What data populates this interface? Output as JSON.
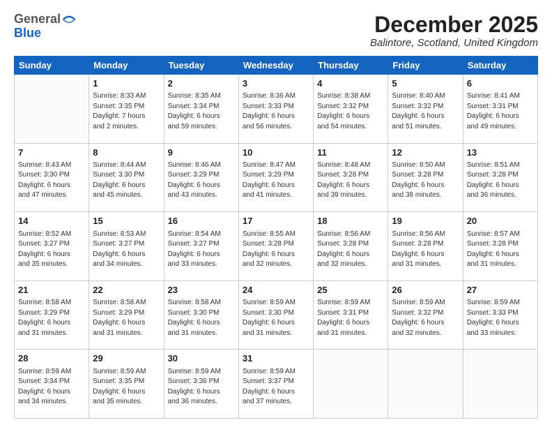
{
  "header": {
    "logo_general": "General",
    "logo_blue": "Blue",
    "month_title": "December 2025",
    "location": "Balintore, Scotland, United Kingdom"
  },
  "weekdays": [
    "Sunday",
    "Monday",
    "Tuesday",
    "Wednesday",
    "Thursday",
    "Friday",
    "Saturday"
  ],
  "weeks": [
    [
      {
        "day": "",
        "info": ""
      },
      {
        "day": "1",
        "info": "Sunrise: 8:33 AM\nSunset: 3:35 PM\nDaylight: 7 hours\nand 2 minutes."
      },
      {
        "day": "2",
        "info": "Sunrise: 8:35 AM\nSunset: 3:34 PM\nDaylight: 6 hours\nand 59 minutes."
      },
      {
        "day": "3",
        "info": "Sunrise: 8:36 AM\nSunset: 3:33 PM\nDaylight: 6 hours\nand 56 minutes."
      },
      {
        "day": "4",
        "info": "Sunrise: 8:38 AM\nSunset: 3:32 PM\nDaylight: 6 hours\nand 54 minutes."
      },
      {
        "day": "5",
        "info": "Sunrise: 8:40 AM\nSunset: 3:32 PM\nDaylight: 6 hours\nand 51 minutes."
      },
      {
        "day": "6",
        "info": "Sunrise: 8:41 AM\nSunset: 3:31 PM\nDaylight: 6 hours\nand 49 minutes."
      }
    ],
    [
      {
        "day": "7",
        "info": "Sunrise: 8:43 AM\nSunset: 3:30 PM\nDaylight: 6 hours\nand 47 minutes."
      },
      {
        "day": "8",
        "info": "Sunrise: 8:44 AM\nSunset: 3:30 PM\nDaylight: 6 hours\nand 45 minutes."
      },
      {
        "day": "9",
        "info": "Sunrise: 8:46 AM\nSunset: 3:29 PM\nDaylight: 6 hours\nand 43 minutes."
      },
      {
        "day": "10",
        "info": "Sunrise: 8:47 AM\nSunset: 3:29 PM\nDaylight: 6 hours\nand 41 minutes."
      },
      {
        "day": "11",
        "info": "Sunrise: 8:48 AM\nSunset: 3:28 PM\nDaylight: 6 hours\nand 39 minutes."
      },
      {
        "day": "12",
        "info": "Sunrise: 8:50 AM\nSunset: 3:28 PM\nDaylight: 6 hours\nand 38 minutes."
      },
      {
        "day": "13",
        "info": "Sunrise: 8:51 AM\nSunset: 3:28 PM\nDaylight: 6 hours\nand 36 minutes."
      }
    ],
    [
      {
        "day": "14",
        "info": "Sunrise: 8:52 AM\nSunset: 3:27 PM\nDaylight: 6 hours\nand 35 minutes."
      },
      {
        "day": "15",
        "info": "Sunrise: 8:53 AM\nSunset: 3:27 PM\nDaylight: 6 hours\nand 34 minutes."
      },
      {
        "day": "16",
        "info": "Sunrise: 8:54 AM\nSunset: 3:27 PM\nDaylight: 6 hours\nand 33 minutes."
      },
      {
        "day": "17",
        "info": "Sunrise: 8:55 AM\nSunset: 3:28 PM\nDaylight: 6 hours\nand 32 minutes."
      },
      {
        "day": "18",
        "info": "Sunrise: 8:56 AM\nSunset: 3:28 PM\nDaylight: 6 hours\nand 32 minutes."
      },
      {
        "day": "19",
        "info": "Sunrise: 8:56 AM\nSunset: 3:28 PM\nDaylight: 6 hours\nand 31 minutes."
      },
      {
        "day": "20",
        "info": "Sunrise: 8:57 AM\nSunset: 3:28 PM\nDaylight: 6 hours\nand 31 minutes."
      }
    ],
    [
      {
        "day": "21",
        "info": "Sunrise: 8:58 AM\nSunset: 3:29 PM\nDaylight: 6 hours\nand 31 minutes."
      },
      {
        "day": "22",
        "info": "Sunrise: 8:58 AM\nSunset: 3:29 PM\nDaylight: 6 hours\nand 31 minutes."
      },
      {
        "day": "23",
        "info": "Sunrise: 8:58 AM\nSunset: 3:30 PM\nDaylight: 6 hours\nand 31 minutes."
      },
      {
        "day": "24",
        "info": "Sunrise: 8:59 AM\nSunset: 3:30 PM\nDaylight: 6 hours\nand 31 minutes."
      },
      {
        "day": "25",
        "info": "Sunrise: 8:59 AM\nSunset: 3:31 PM\nDaylight: 6 hours\nand 31 minutes."
      },
      {
        "day": "26",
        "info": "Sunrise: 8:59 AM\nSunset: 3:32 PM\nDaylight: 6 hours\nand 32 minutes."
      },
      {
        "day": "27",
        "info": "Sunrise: 8:59 AM\nSunset: 3:33 PM\nDaylight: 6 hours\nand 33 minutes."
      }
    ],
    [
      {
        "day": "28",
        "info": "Sunrise: 8:59 AM\nSunset: 3:34 PM\nDaylight: 6 hours\nand 34 minutes."
      },
      {
        "day": "29",
        "info": "Sunrise: 8:59 AM\nSunset: 3:35 PM\nDaylight: 6 hours\nand 35 minutes."
      },
      {
        "day": "30",
        "info": "Sunrise: 8:59 AM\nSunset: 3:36 PM\nDaylight: 6 hours\nand 36 minutes."
      },
      {
        "day": "31",
        "info": "Sunrise: 8:59 AM\nSunset: 3:37 PM\nDaylight: 6 hours\nand 37 minutes."
      },
      {
        "day": "",
        "info": ""
      },
      {
        "day": "",
        "info": ""
      },
      {
        "day": "",
        "info": ""
      }
    ]
  ]
}
